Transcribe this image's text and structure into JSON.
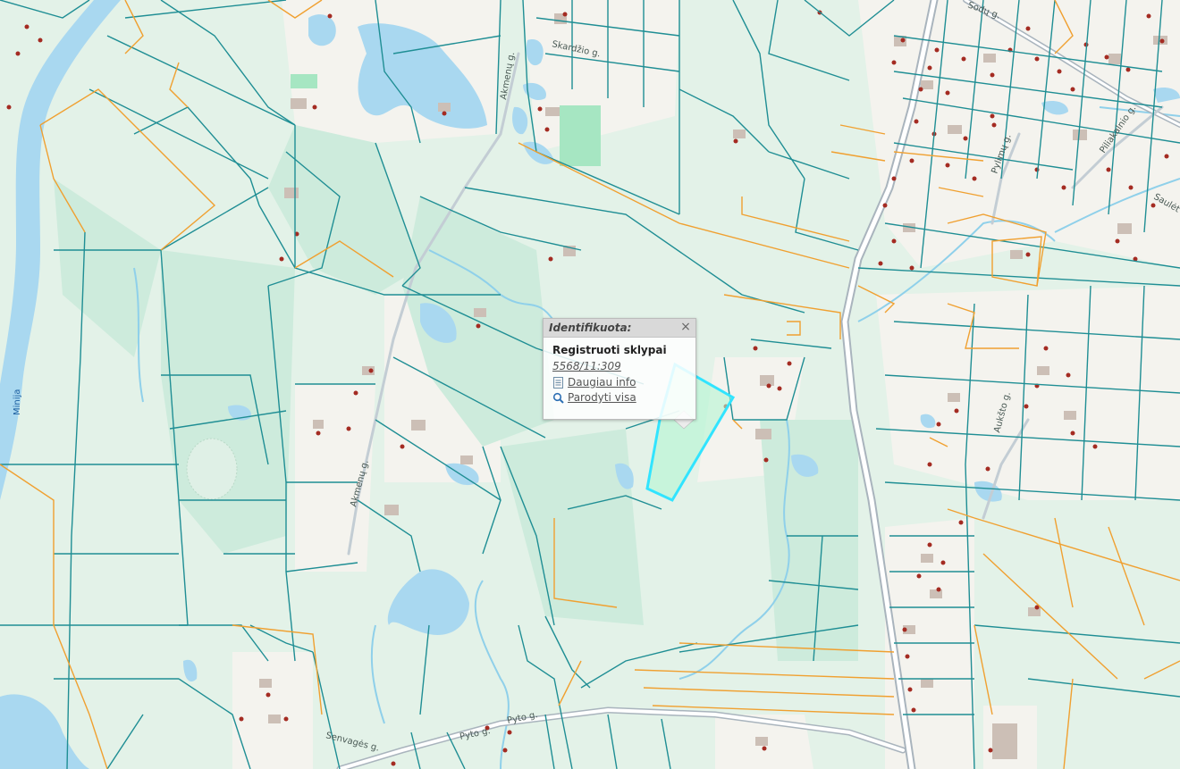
{
  "map": {
    "river_label": "Minija",
    "street_labels": {
      "akmenu": "Akmenų g.",
      "akmenu_north": "Akmenų g.",
      "skardzio": "Skardžio g.",
      "pylimu": "Pylimų g.",
      "piliakalnio": "Piliakalnio g.",
      "sauleteikio": "Saulėt",
      "aukstoji": "Aukšto g.",
      "senvages": "Senvagės g.",
      "pyto_1": "Pyto g.",
      "pyto_2": "Pyto g.",
      "topright": "Sodų g."
    },
    "colors": {
      "water": "#a9d8f0",
      "meadow": "#d3ede0",
      "parcel_line": "#1f8e94",
      "orange_line": "#f0a030",
      "road": "#aab6bf",
      "selection": "#31e4ff",
      "building": "#ccbfb6",
      "house_dot": "#a42b22"
    }
  },
  "popup": {
    "header": "Identifikuota:",
    "close_symbol": "×",
    "title": "Registruoti sklypai",
    "parcel_id": "5568/11:309",
    "more_info": "Daugiau info",
    "show_all": "Parodyti visa"
  }
}
